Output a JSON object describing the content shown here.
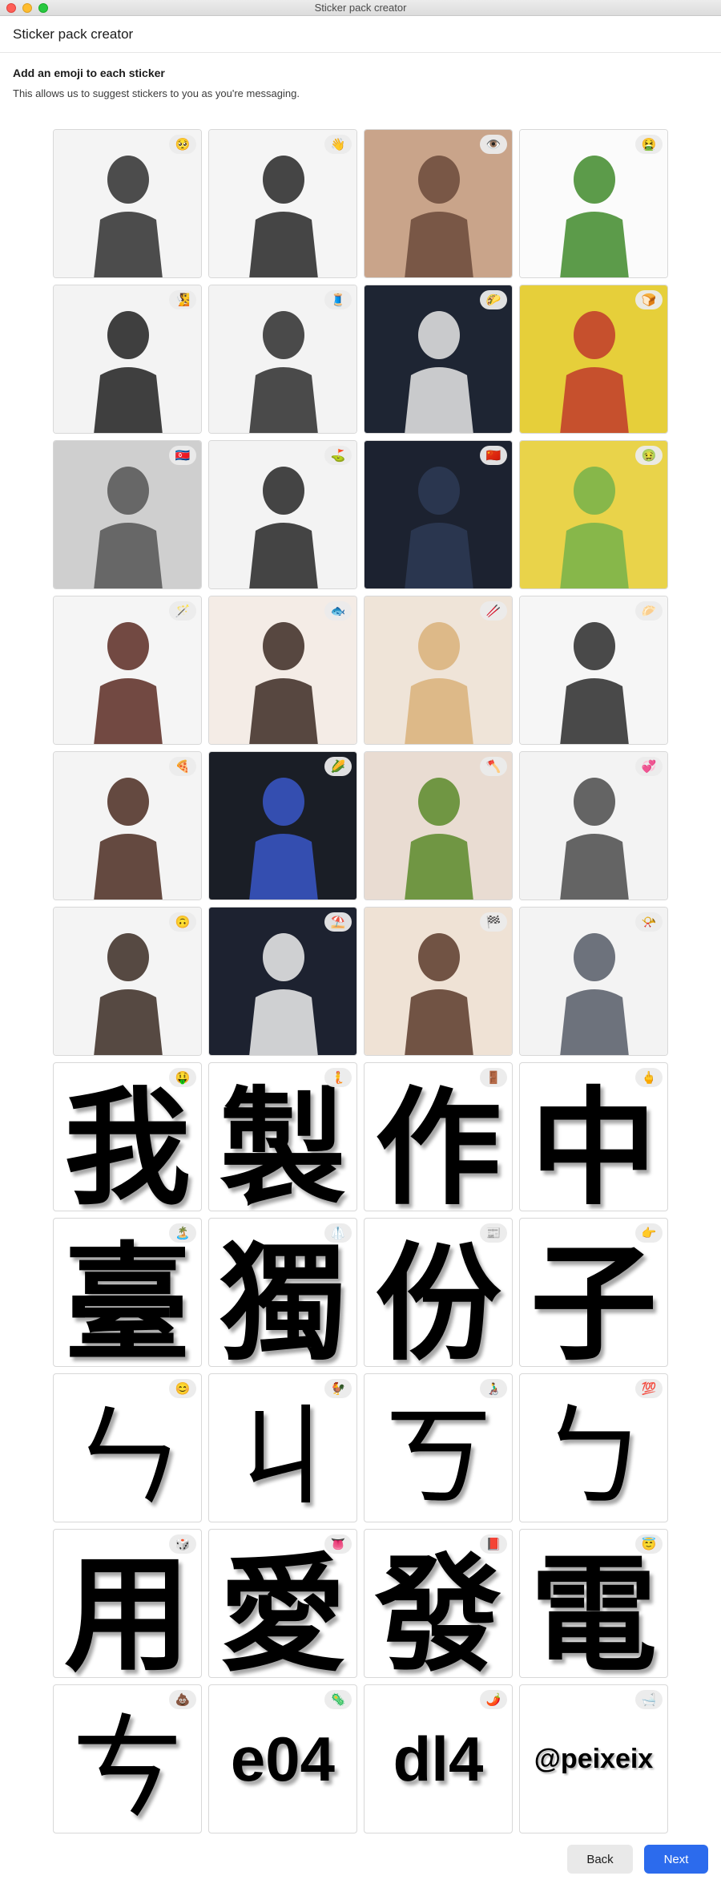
{
  "window": {
    "title": "Sticker pack creator"
  },
  "header": {
    "title": "Sticker pack creator"
  },
  "instructions": {
    "title": "Add an emoji to each sticker",
    "subtitle": "This allows us to suggest stickers to you as you're messaging."
  },
  "stickers": [
    {
      "type": "photo",
      "emoji": "🥺",
      "bg": "#f4f4f4",
      "fg": "#2e2e2e"
    },
    {
      "type": "photo",
      "emoji": "👋",
      "bg": "#f5f5f5",
      "fg": "#262626"
    },
    {
      "type": "photo",
      "emoji": "👁️",
      "bg": "#c9a48a",
      "fg": "#6b4a3a"
    },
    {
      "type": "photo",
      "emoji": "🤮",
      "bg": "#fbfbfb",
      "fg": "#3f8a2a"
    },
    {
      "type": "photo",
      "emoji": "🧏",
      "bg": "#f3f3f3",
      "fg": "#1f1f1f"
    },
    {
      "type": "photo",
      "emoji": "🧵",
      "bg": "#f3f3f3",
      "fg": "#2b2b2b"
    },
    {
      "type": "photo",
      "emoji": "🌮",
      "bg": "#1e2533",
      "fg": "#e8e8e8"
    },
    {
      "type": "photo",
      "emoji": "🍞",
      "bg": "#e6cf3a",
      "fg": "#c0392b"
    },
    {
      "type": "photo",
      "emoji": "🇰🇵",
      "bg": "#cfcfcf",
      "fg": "#555555"
    },
    {
      "type": "photo",
      "emoji": "⛳",
      "bg": "#f3f3f3",
      "fg": "#242424"
    },
    {
      "type": "photo",
      "emoji": "🇨🇳",
      "bg": "#1c2230",
      "fg": "#2d3a55"
    },
    {
      "type": "photo",
      "emoji": "🤢",
      "bg": "#e9d34a",
      "fg": "#76b14a"
    },
    {
      "type": "photo",
      "emoji": "🪄",
      "bg": "#f5f5f5",
      "fg": "#5a2a22"
    },
    {
      "type": "photo",
      "emoji": "🐟",
      "bg": "#f4ece6",
      "fg": "#3b2a22"
    },
    {
      "type": "photo",
      "emoji": "🥢",
      "bg": "#efe4d8",
      "fg": "#d9b27a"
    },
    {
      "type": "photo",
      "emoji": "🥟",
      "bg": "#f6f6f6",
      "fg": "#2a2a2a"
    },
    {
      "type": "photo",
      "emoji": "🍕",
      "bg": "#f4f4f4",
      "fg": "#4a2a20"
    },
    {
      "type": "photo",
      "emoji": "🌽",
      "bg": "#1a1e26",
      "fg": "#3a57c9"
    },
    {
      "type": "photo",
      "emoji": "🪓",
      "bg": "#e9dcd2",
      "fg": "#5a8a2a"
    },
    {
      "type": "photo",
      "emoji": "💞",
      "bg": "#f3f3f3",
      "fg": "#4a4a4a"
    },
    {
      "type": "photo",
      "emoji": "🙃",
      "bg": "#f4f4f4",
      "fg": "#3a2a22"
    },
    {
      "type": "photo",
      "emoji": "⛱️",
      "bg": "#1d2230",
      "fg": "#eeeeee"
    },
    {
      "type": "photo",
      "emoji": "🏁",
      "bg": "#efe2d5",
      "fg": "#5a3a2a"
    },
    {
      "type": "photo",
      "emoji": "📯",
      "bg": "#f3f3f3",
      "fg": "#555a66"
    },
    {
      "type": "glyph",
      "text": "我",
      "size": "big",
      "emoji": "🤑"
    },
    {
      "type": "glyph",
      "text": "製",
      "size": "big",
      "emoji": "🧜"
    },
    {
      "type": "glyph",
      "text": "作",
      "size": "big",
      "emoji": "🚪"
    },
    {
      "type": "glyph",
      "text": "中",
      "size": "big",
      "emoji": "🖕"
    },
    {
      "type": "glyph",
      "text": "臺",
      "size": "big",
      "emoji": "🏝️"
    },
    {
      "type": "glyph",
      "text": "獨",
      "size": "big",
      "emoji": "🥼"
    },
    {
      "type": "glyph",
      "text": "份",
      "size": "big",
      "emoji": "📰"
    },
    {
      "type": "glyph",
      "text": "子",
      "size": "big",
      "emoji": "👉"
    },
    {
      "type": "glyph",
      "text": "ㄣ",
      "size": "phon",
      "emoji": "😊"
    },
    {
      "type": "glyph",
      "text": "ㄐ",
      "size": "phon",
      "emoji": "🐓"
    },
    {
      "type": "glyph",
      "text": "ㄎ",
      "size": "phon",
      "emoji": "👨‍🦽"
    },
    {
      "type": "glyph",
      "text": "ㄅ",
      "size": "phon",
      "emoji": "💯"
    },
    {
      "type": "glyph",
      "text": "用",
      "size": "big",
      "emoji": "🎲"
    },
    {
      "type": "glyph",
      "text": "愛",
      "size": "big",
      "emoji": "👅"
    },
    {
      "type": "glyph",
      "text": "發",
      "size": "big",
      "emoji": "📕"
    },
    {
      "type": "glyph",
      "text": "電",
      "size": "big",
      "emoji": "😇"
    },
    {
      "type": "glyph",
      "text": "ㄘ",
      "size": "phon",
      "emoji": "💩"
    },
    {
      "type": "glyph",
      "text": "e04",
      "size": "text",
      "emoji": "🦠"
    },
    {
      "type": "glyph",
      "text": "dl4",
      "size": "text",
      "emoji": "🌶️"
    },
    {
      "type": "glyph",
      "text": "@peixeix",
      "size": "handle",
      "emoji": "🛁"
    }
  ],
  "footer": {
    "back_label": "Back",
    "next_label": "Next"
  },
  "colors": {
    "accent": "#2c6bed",
    "secondary_button": "#e9e9e9"
  }
}
